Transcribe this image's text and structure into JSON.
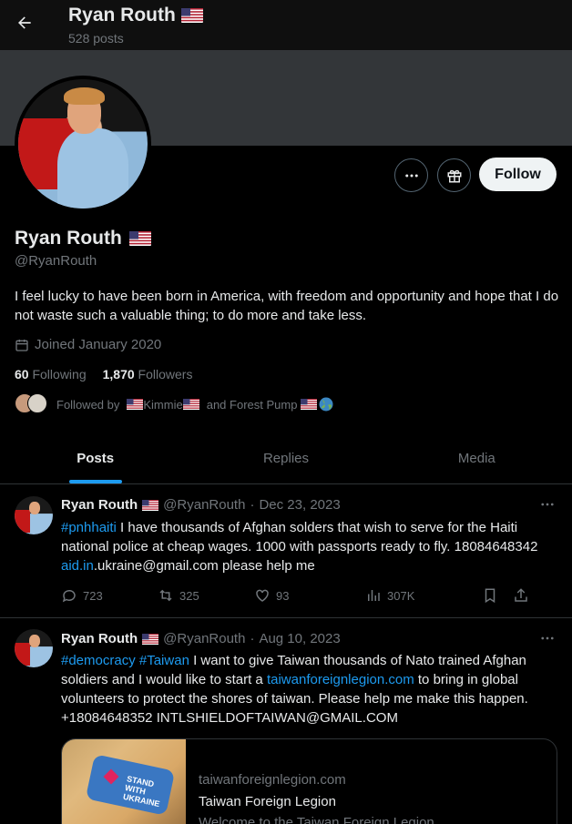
{
  "header": {
    "title": "Ryan Routh",
    "posts_count": "528 posts"
  },
  "profile": {
    "name": "Ryan Routh",
    "handle": "@RyanRouth",
    "bio": "I feel lucky to have been born in America, with freedom and opportunity and hope that I do not waste such a valuable thing; to do more and take less.",
    "joined": "Joined January 2020",
    "following_count": "60",
    "following_label": "Following",
    "followers_count": "1,870",
    "followers_label": "Followers",
    "followed_by_prefix": "Followed by",
    "followed_by_1": "Kimmie",
    "followed_by_and": "and Forest Pump",
    "follow_label": "Follow"
  },
  "tabs": [
    {
      "label": "Posts",
      "active": true
    },
    {
      "label": "Replies",
      "active": false
    },
    {
      "label": "Media",
      "active": false
    }
  ],
  "tweets": [
    {
      "name": "Ryan Routh",
      "handle": "@RyanRouth",
      "sep": "·",
      "date": "Dec 23, 2023",
      "hashtag": "#pnhhaiti",
      "text_1": " I have thousands of Afghan solders that wish to serve for the Haiti national police at cheap wages. 1000 with passports ready to fly. 18084648342 ",
      "link": "aid.in",
      "text_2": ".ukraine@gmail.com please help me",
      "replies": "723",
      "reposts": "325",
      "likes": "93",
      "views": "307K"
    },
    {
      "name": "Ryan Routh",
      "handle": "@RyanRouth",
      "sep": "·",
      "date": "Aug 10, 2023",
      "hashtag_1": "#democracy",
      "hashtag_2": "#Taiwan",
      "text_1": " I want to give Taiwan thousands of Nato trained Afghan soldiers and I would like to start a ",
      "link": "taiwanforeignlegion.com",
      "text_2": " to bring in global volunteers to protect the shores of taiwan.    Please help me make this happen. +18084648352 INTLSHIELDOFTAIWAN@GMAIL.COM",
      "card_domain": "taiwanforeignlegion.com",
      "card_title": "Taiwan Foreign Legion",
      "card_desc": "Welcome to the Taiwan Foreign Legion",
      "card_image_text": "STAND WITH UKRAINE"
    }
  ],
  "colors": {
    "accent": "#1d9bf0",
    "background": "#000000",
    "secondary_text": "#71767b"
  }
}
